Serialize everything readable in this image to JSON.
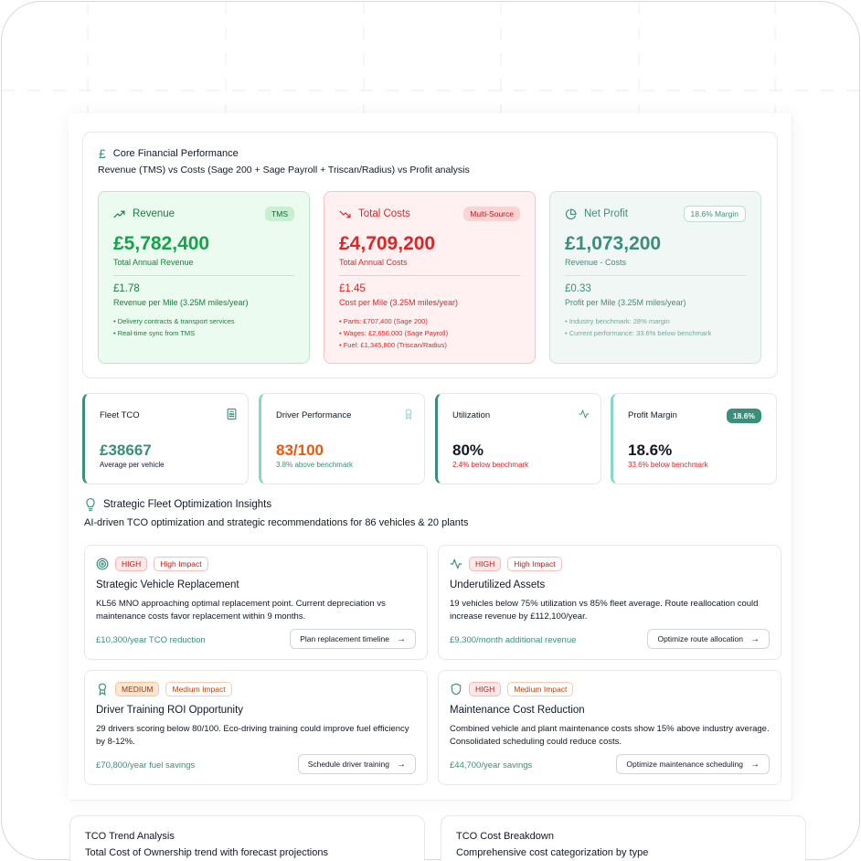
{
  "colors": {
    "accent": "#3b8e7c",
    "revenue": "#16a34a",
    "cost": "#dc2626",
    "orange": "#ea580c"
  },
  "core": {
    "icon": "pound-icon",
    "title": "Core Financial Performance",
    "subtitle": "Revenue (TMS) vs Costs (Sage 200 + Sage Payroll + Triscan/Radius) vs Profit analysis",
    "revenue": {
      "label": "Revenue",
      "badge": "TMS",
      "amount": "£5,782,400",
      "amount_label": "Total Annual Revenue",
      "rate": "£1.78",
      "rate_label": "Revenue per Mile (3.25M miles/year)",
      "notes": [
        "• Delivery contracts & transport services",
        "• Real-time sync from TMS"
      ]
    },
    "costs": {
      "label": "Total Costs",
      "badge": "Multi-Source",
      "amount": "£4,709,200",
      "amount_label": "Total Annual Costs",
      "rate": "£1.45",
      "rate_label": "Cost per Mile (3.25M miles/year)",
      "notes": [
        "• Parts: £707,400 (Sage 200)",
        "• Wages: £2,656,000 (Sage Payroll)",
        "• Fuel: £1,345,800 (Triscan/Radius)"
      ]
    },
    "profit": {
      "label": "Net Profit",
      "badge": "18.6% Margin",
      "amount": "£1,073,200",
      "amount_label": "Revenue - Costs",
      "rate": "£0.33",
      "rate_label": "Profit per Mile (3.25M miles/year)",
      "notes": [
        "• Industry benchmark: 28% margin",
        "• Current performance: 33.6% below benchmark"
      ]
    }
  },
  "kpis": [
    {
      "title": "Fleet TCO",
      "icon": "calculator-icon",
      "value": "£38667",
      "sub": "Average per vehicle"
    },
    {
      "title": "Driver Performance",
      "icon": "award-icon",
      "value": "83/100",
      "sub": "3.8% above benchmark"
    },
    {
      "title": "Utilization",
      "icon": "activity-icon",
      "value": "80%",
      "sub": "2.4% below benchmark"
    },
    {
      "title": "Profit Margin",
      "badge": "18.6%",
      "value": "18.6%",
      "sub": "33.6% below benchmark"
    }
  ],
  "insights": {
    "icon": "lightbulb-icon",
    "title": "Strategic Fleet Optimization Insights",
    "subtitle": "AI-driven TCO optimization and strategic recommendations for 86 vehicles & 20 plants",
    "cards": [
      {
        "icon": "target-icon",
        "priority": "HIGH",
        "impact": "High Impact",
        "title": "Strategic Vehicle Replacement",
        "desc": "KL56 MNO approaching optimal replacement point. Current depreciation vs maintenance costs favor replacement within 9 months.",
        "value": "£10,300/year TCO reduction",
        "action": "Plan replacement timeline"
      },
      {
        "icon": "activity-icon",
        "priority": "HIGH",
        "impact": "High Impact",
        "title": "Underutilized Assets",
        "desc": "19 vehicles below 75% utilization vs 85% fleet average. Route reallocation could increase revenue by £112,100/year.",
        "value": "£9,300/month additional revenue",
        "action": "Optimize route allocation"
      },
      {
        "icon": "award-icon",
        "priority": "MEDIUM",
        "impact": "Medium Impact",
        "title": "Driver Training ROI Opportunity",
        "desc": "29 drivers scoring below 80/100. Eco-driving training could improve fuel efficiency by 8-12%.",
        "value": "£70,800/year fuel savings",
        "action": "Schedule driver training"
      },
      {
        "icon": "shield-icon",
        "priority": "HIGH",
        "impact": "Medium Impact",
        "title": "Maintenance Cost Reduction",
        "desc": "Combined vehicle and plant maintenance costs show 15% above industry average. Consolidated scheduling could reduce costs.",
        "value": "£44,700/year savings",
        "action": "Optimize maintenance scheduling"
      }
    ]
  },
  "bottom": {
    "trend": {
      "title": "TCO Trend Analysis",
      "subtitle": "Total Cost of Ownership trend with forecast projections"
    },
    "breakdown": {
      "title": "TCO Cost Breakdown",
      "subtitle": "Comprehensive cost categorization by type"
    }
  }
}
